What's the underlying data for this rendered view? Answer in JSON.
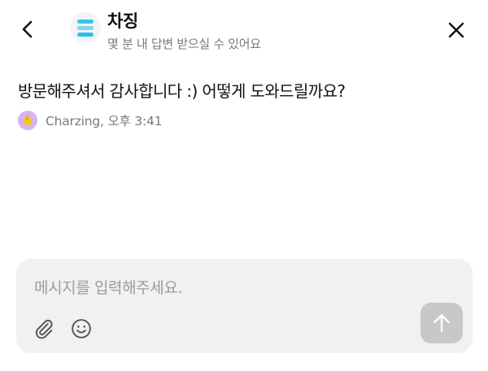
{
  "header": {
    "channel_name": "차징",
    "reply_time": "몇 분 내 답변 받으실 수 있어요",
    "logo_colors": [
      "#38c6e8",
      "#7fd6ea",
      "#2bbfe0"
    ],
    "back_icon": "chevron-left-icon",
    "close_icon": "close-icon"
  },
  "messages": [
    {
      "text": "방문해주셔서 감사합니다 :) 어떻게 도와드릴까요?",
      "sender": "Charzing",
      "time": "오후 3:41",
      "sender_info": "Charzing, 오후 3:41",
      "avatar_color": "#d6b3f5"
    }
  ],
  "composer": {
    "placeholder": "메시지를 입력해주세요.",
    "value": "",
    "attach_icon": "paperclip-icon",
    "emoji_icon": "smiley-icon",
    "send_icon": "arrow-up-icon",
    "send_button_color": "#c8c8c8"
  }
}
